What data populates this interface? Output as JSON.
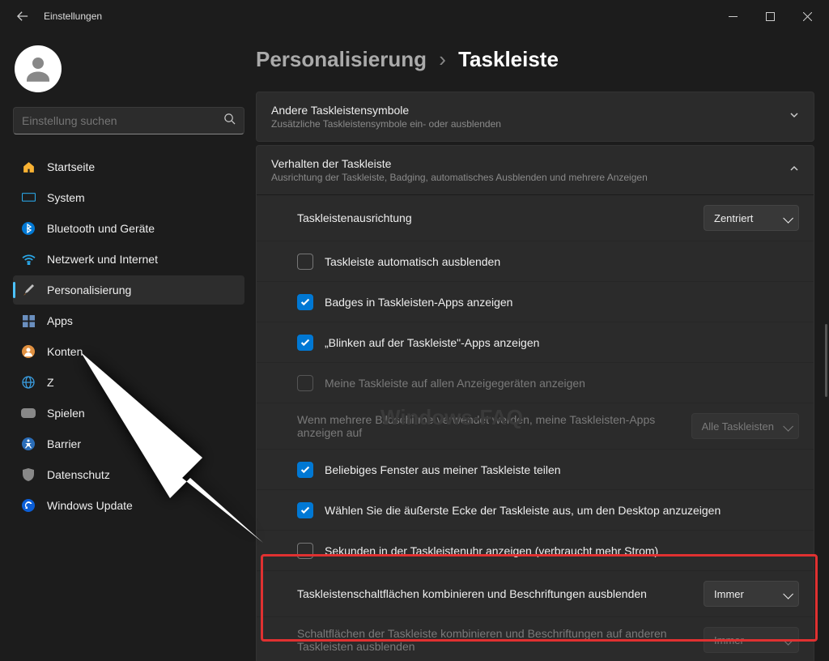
{
  "window": {
    "title": "Einstellungen"
  },
  "search": {
    "placeholder": "Einstellung suchen"
  },
  "sidebar": {
    "items": [
      {
        "label": "Startseite"
      },
      {
        "label": "System"
      },
      {
        "label": "Bluetooth und Geräte"
      },
      {
        "label": "Netzwerk und Internet"
      },
      {
        "label": "Personalisierung"
      },
      {
        "label": "Apps"
      },
      {
        "label": "Konten"
      },
      {
        "label": "Z"
      },
      {
        "label": "Spielen"
      },
      {
        "label": "Barrier"
      },
      {
        "label": "Datenschutz"
      },
      {
        "label": "Windows Update"
      }
    ]
  },
  "breadcrumb": {
    "parent": "Personalisierung",
    "sep": "›",
    "current": "Taskleiste"
  },
  "sections": {
    "other": {
      "title": "Andere Taskleistensymbole",
      "sub": "Zusätzliche Taskleistensymbole ein- oder ausblenden"
    },
    "behavior": {
      "title": "Verhalten der Taskleiste",
      "sub": "Ausrichtung der Taskleiste, Badging, automatisches Ausblenden und mehrere Anzeigen",
      "rows": {
        "alignment": {
          "label": "Taskleistenausrichtung",
          "value": "Zentriert"
        },
        "autohide": {
          "label": "Taskleiste automatisch ausblenden"
        },
        "badges": {
          "label": "Badges in Taskleisten-Apps anzeigen"
        },
        "flash": {
          "label": "„Blinken auf der Taskleiste\"-Apps anzeigen"
        },
        "alldisplays": {
          "label": "Meine Taskleiste auf allen Anzeigegeräten anzeigen"
        },
        "multi": {
          "label": "Wenn mehrere Bildschirme verwendet werden, meine Taskleisten-Apps anzeigen auf",
          "value": "Alle Taskleisten"
        },
        "share": {
          "label": "Beliebiges Fenster aus meiner Taskleiste teilen"
        },
        "corner": {
          "label": "Wählen Sie die äußerste Ecke der Taskleiste aus, um den Desktop anzuzeigen"
        },
        "seconds": {
          "label": "Sekunden in der Taskleistenuhr anzeigen (verbraucht mehr Strom)"
        },
        "combine1": {
          "label": "Taskleistenschaltflächen kombinieren und Beschriftungen ausblenden",
          "value": "Immer"
        },
        "combine2": {
          "label": "Schaltflächen der Taskleiste kombinieren und Beschriftungen auf anderen Taskleisten ausblenden",
          "value": "Immer"
        }
      }
    }
  },
  "watermark": "Windows-FAQ"
}
